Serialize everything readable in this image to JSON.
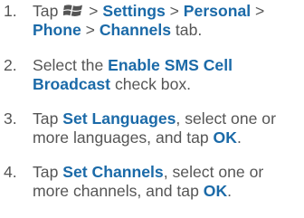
{
  "steps": [
    {
      "number": "1.",
      "tap": "Tap",
      "start_icon": "windows-start-icon",
      "sep1": ">",
      "settings": "Settings",
      "sep2": ">",
      "personal": "Personal",
      "sep3": ">",
      "phone": "Phone",
      "sep4": ">",
      "channels": "Channels",
      "tab": "tab."
    },
    {
      "number": "2.",
      "pre": "Select the",
      "bold": "Enable SMS Cell Broadcast",
      "post": "check box."
    },
    {
      "number": "3.",
      "pre": "Tap",
      "bold": "Set Languages",
      "mid": ", select one or more languages, and tap",
      "ok": "OK",
      "end": "."
    },
    {
      "number": "4.",
      "pre": "Tap",
      "bold": "Set Channels",
      "mid": ", select one or more channels, and tap",
      "ok": "OK",
      "end": "."
    }
  ],
  "colors": {
    "body_text": "#555555",
    "ui_term": "#1b6aa8"
  }
}
